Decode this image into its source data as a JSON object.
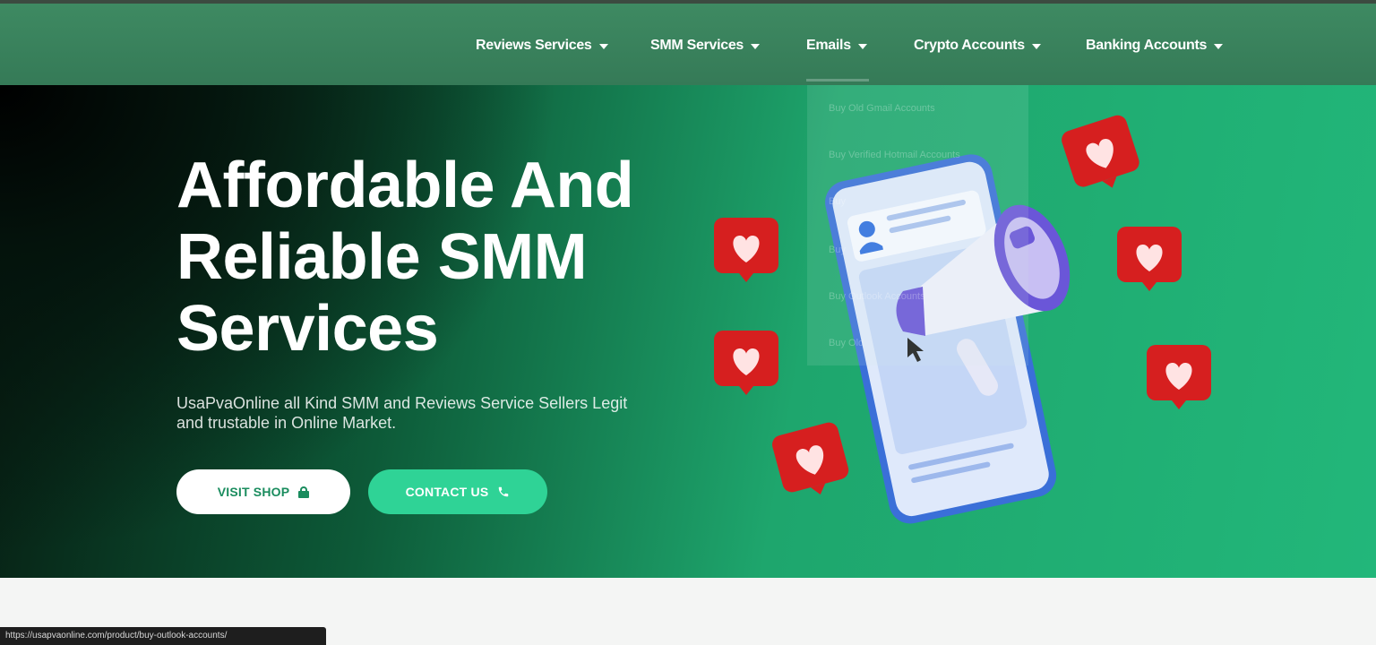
{
  "nav": {
    "items": [
      {
        "label": "Reviews Services"
      },
      {
        "label": "SMM Services"
      },
      {
        "label": "Emails"
      },
      {
        "label": "Crypto Accounts"
      },
      {
        "label": "Banking Accounts"
      }
    ]
  },
  "hero": {
    "headline_lines": [
      "Affordable And",
      "Reliable SMM",
      "Services"
    ],
    "subtext_lines": [
      "UsaPvaOnline all Kind SMM and Reviews Service Sellers Legit",
      "and trustable in Online Market."
    ],
    "buttons": {
      "visit": "VISIT SHOP",
      "contact": "CONTACT US"
    }
  },
  "dropdown": {
    "items": [
      "Buy Old Gmail Accounts",
      "Buy Verified Hotmail Accounts",
      "Buy",
      "Buy",
      "Buy Outlook Accounts",
      "Buy Old"
    ]
  },
  "status": {
    "url": "https://usapvaonline.com/product/buy-outlook-accounts/"
  },
  "colors": {
    "nav_bg": "#3e8a62",
    "hero_green": "#22b77a",
    "contact_btn": "#2fd396",
    "heart_red": "#d61f1f"
  },
  "icons": {
    "visit": "lock-icon",
    "contact": "phone-icon",
    "dropdown_caret": "chevron-down-icon"
  }
}
